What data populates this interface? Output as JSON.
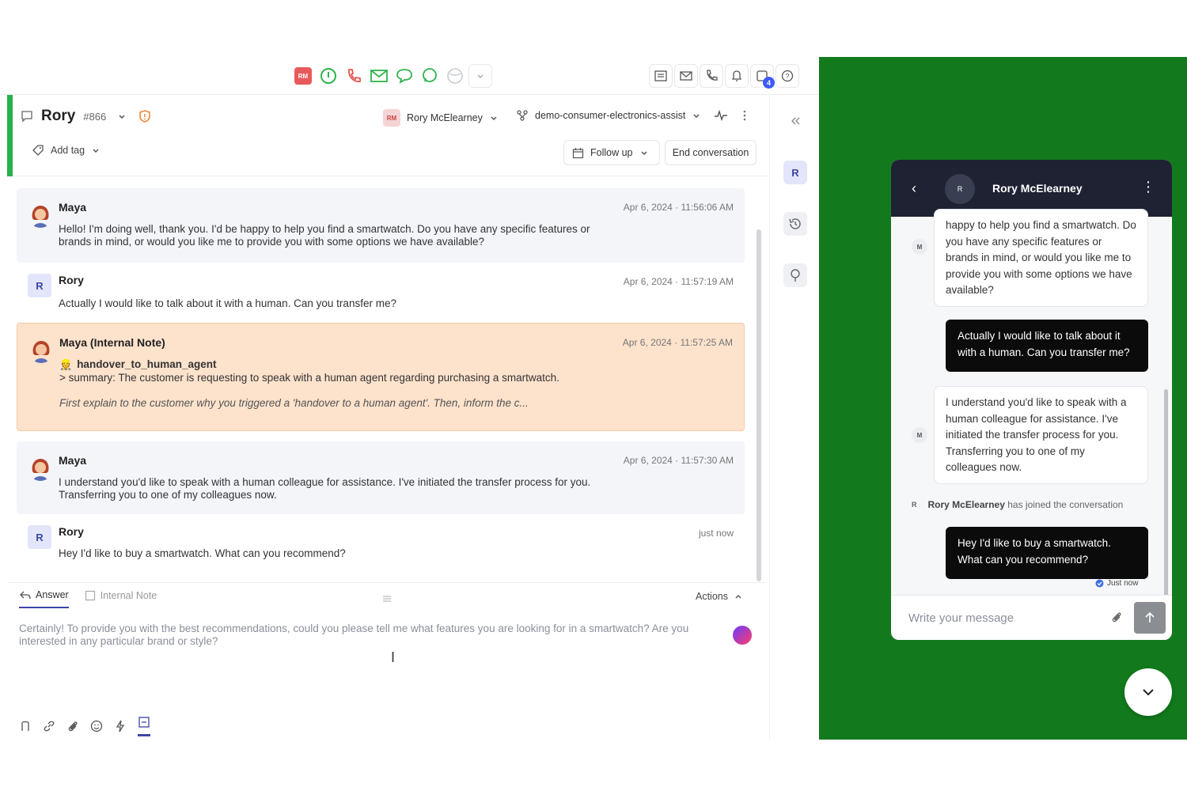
{
  "topbar": {
    "agent_initials": "RM",
    "notification_count": "4"
  },
  "conversation": {
    "name": "Rory",
    "id": "#866",
    "assignee_initials": "RM",
    "assignee_name": "Rory McElearney",
    "bot_name": "demo-consumer-electronics-assist",
    "add_tag_label": "Add tag",
    "follow_up_label": "Follow up",
    "end_conversation_label": "End conversation"
  },
  "messages": [
    {
      "author": "Maya",
      "time": "Apr 6, 2024 · 11:56:06 AM",
      "text": "Hello! I'm doing well, thank you. I'd be happy to help you find a smartwatch. Do you have any specific features or brands in mind, or would you like me to provide you with some options we have available?"
    },
    {
      "author": "Rory",
      "initial": "R",
      "time": "Apr 6, 2024 · 11:57:19 AM",
      "text": "Actually I would like to talk about it with a human. Can you transfer me?"
    },
    {
      "author": "Maya  (Internal Note)",
      "time": "Apr 6, 2024 · 11:57:25 AM",
      "handover": "handover_to_human_agent",
      "summary": "> summary: The customer is requesting to speak with a human agent regarding purchasing a smartwatch.",
      "instruction": "First explain to the customer why you triggered a 'handover to a human agent'. Then, inform the c..."
    },
    {
      "author": "Maya",
      "time": "Apr 6, 2024 · 11:57:30 AM",
      "text": "I understand you'd like to speak with a human colleague for assistance. I've initiated the transfer process for you. Transferring you to one of my colleagues now."
    },
    {
      "author": "Rory",
      "initial": "R",
      "time": "just now",
      "text": "Hey I'd like to buy a smartwatch. What can you recommend?"
    }
  ],
  "composer": {
    "tab_answer": "Answer",
    "tab_internal_note": "Internal Note",
    "actions_label": "Actions",
    "draft_text": "Certainly! To provide you with the best recommendations, could you please tell me what features you are looking for in a smartwatch? Are you interested in any particular brand or style?"
  },
  "rail": {
    "user_initial": "R"
  },
  "widget": {
    "header_initial": "R",
    "header_name": "Rory McElearney",
    "bot_initial": "M",
    "user_initial": "R",
    "bot_msg_1": "happy to help you find a smartwatch. Do you have any specific features or brands in mind, or would you like me to provide you with some options we have available?",
    "user_msg_1": "Actually I would like to talk about it with a human. Can you transfer me?",
    "bot_msg_2": "I understand you'd like to speak with a human colleague for assistance. I've initiated the transfer process for you. Transferring you to one of my colleagues now.",
    "joined_name": "Rory McElearney",
    "joined_text": "has joined the conversation",
    "user_msg_2": "Hey I'd like to buy a smartwatch. What can you recommend?",
    "just_now": "Just now",
    "input_placeholder": "Write your message"
  },
  "colors": {
    "green_bg": "#127a1c",
    "note_bg": "#fde2cc",
    "accent": "#3c46a8",
    "status_green": "#27b14a"
  }
}
